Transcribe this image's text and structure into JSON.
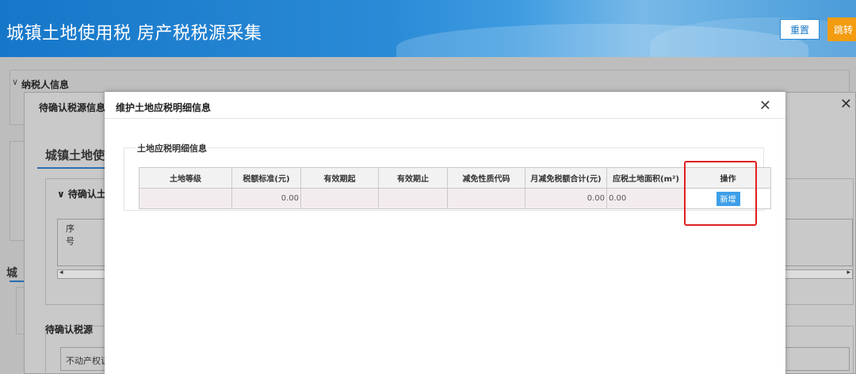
{
  "header": {
    "title": "城镇土地使用税 房产税税源采集",
    "reset_label": "重置",
    "jump_label": "跳转"
  },
  "background": {
    "taxpayer_section": "纳税人信息",
    "pending_dialog_title": "待确认税源信息",
    "pending_subtitle": "城镇土地使",
    "pending_land_section": "待确认土",
    "seq_header": "序号",
    "pending_info_label": "待确认税源",
    "property_cert_label": "不动产权证",
    "city_fragment": "城"
  },
  "modal": {
    "title": "维护土地应税明细信息",
    "fieldset_legend": "土地应税明细信息",
    "columns": [
      "土地等级",
      "税额标准(元)",
      "有效期起",
      "有效期止",
      "减免性质代码",
      "月减免税额合计(元)",
      "应税土地面积(m²)",
      "操作"
    ],
    "row": {
      "land_grade": "",
      "tax_standard": "0.00",
      "valid_from": "",
      "valid_to": "",
      "relief_code": "",
      "monthly_relief_total": "0.00",
      "taxable_area": "0.00"
    },
    "add_label": "新增"
  },
  "colors": {
    "header_blue": "#1677c9",
    "jump_orange": "#f39c12",
    "add_blue": "#3e9fe8",
    "highlight_red": "#e02020"
  }
}
